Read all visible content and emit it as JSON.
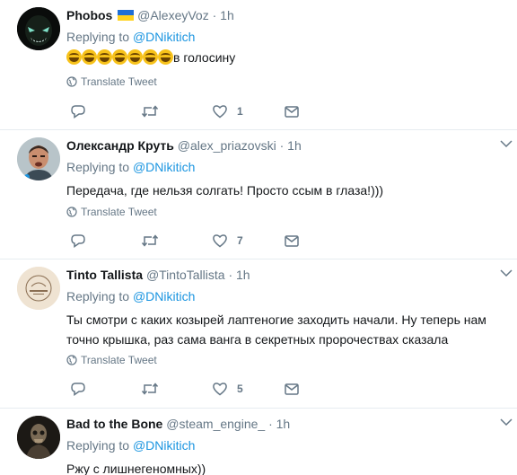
{
  "ui": {
    "replying_to_prefix": "Replying to ",
    "translate_label": "Translate Tweet",
    "dot": "·"
  },
  "tweets": [
    {
      "name": "Phobos",
      "handle": "@AlexeyVoz",
      "time": "1h",
      "reply_to": "@DNikitich",
      "emoji_count": 7,
      "emoji_name": "face-with-tears-of-joy",
      "text": "в голосину",
      "reply_count": "",
      "retweet_count": "",
      "like_count": "1",
      "verified_flag": "ukraine-flag"
    },
    {
      "name": "Олександр Круть",
      "handle": "@alex_priazovski",
      "time": "1h",
      "reply_to": "@DNikitich",
      "text": "Передача, где нельзя солгать! Просто ссым в глаза!)))",
      "reply_count": "",
      "retweet_count": "",
      "like_count": "7"
    },
    {
      "name": "Tinto Tallista",
      "handle": "@TintoTallista",
      "time": "1h",
      "reply_to": "@DNikitich",
      "text": "Ты смотри с каких козырей лаптеногие заходить начали. Ну теперь нам точно крышка, раз сама ванга в секретных пророчествах сказала",
      "reply_count": "",
      "retweet_count": "",
      "like_count": "5"
    },
    {
      "name": "Bad to the Bone",
      "handle": "@steam_engine_",
      "time": "1h",
      "reply_to": "@DNikitich",
      "text": "Ржу с лишнегеномных))"
    }
  ],
  "colors": {
    "link": "#1b95e0",
    "muted": "#657786",
    "text": "#14171a",
    "divider": "#e6ecf0"
  }
}
